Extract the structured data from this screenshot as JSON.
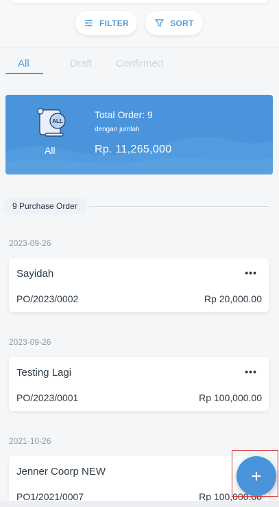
{
  "toolbar": {
    "filter_label": "FILTER",
    "sort_label": "SORT"
  },
  "tabs": [
    {
      "label": "All",
      "active": true
    },
    {
      "label": "Draft",
      "active": false
    },
    {
      "label": "Confirmed",
      "active": false
    }
  ],
  "summary": {
    "icon_text": "ALL",
    "category_label": "All",
    "total_order": "Total Order: 9",
    "subtitle": "dengan jumlah",
    "amount": "Rp. 11,265,000"
  },
  "count_label": "9 Purchase Order",
  "orders": [
    {
      "date": "2023-09-26",
      "name": "Sayidah",
      "po": "PO/2023/0002",
      "price": "Rp 20,000.00",
      "menu": "•••"
    },
    {
      "date": "2023-09-26",
      "name": "Testing Lagi",
      "po": "PO/2023/0001",
      "price": "Rp 100,000.00",
      "menu": "•••"
    },
    {
      "date": "2021-10-26",
      "name": "Jenner Coorp NEW",
      "po": "PO1/2021/0007",
      "price": "Rp 100,000.00",
      "menu": ""
    }
  ],
  "fab": {
    "label": "+"
  },
  "colors": {
    "accent": "#4a94dc",
    "accent_text": "#4e9fd8",
    "highlight": "#dd3333"
  },
  "icons": {
    "filter": "sliders-icon",
    "sort": "funnel-icon",
    "all": "scroll-icon",
    "add": "plus-icon"
  }
}
